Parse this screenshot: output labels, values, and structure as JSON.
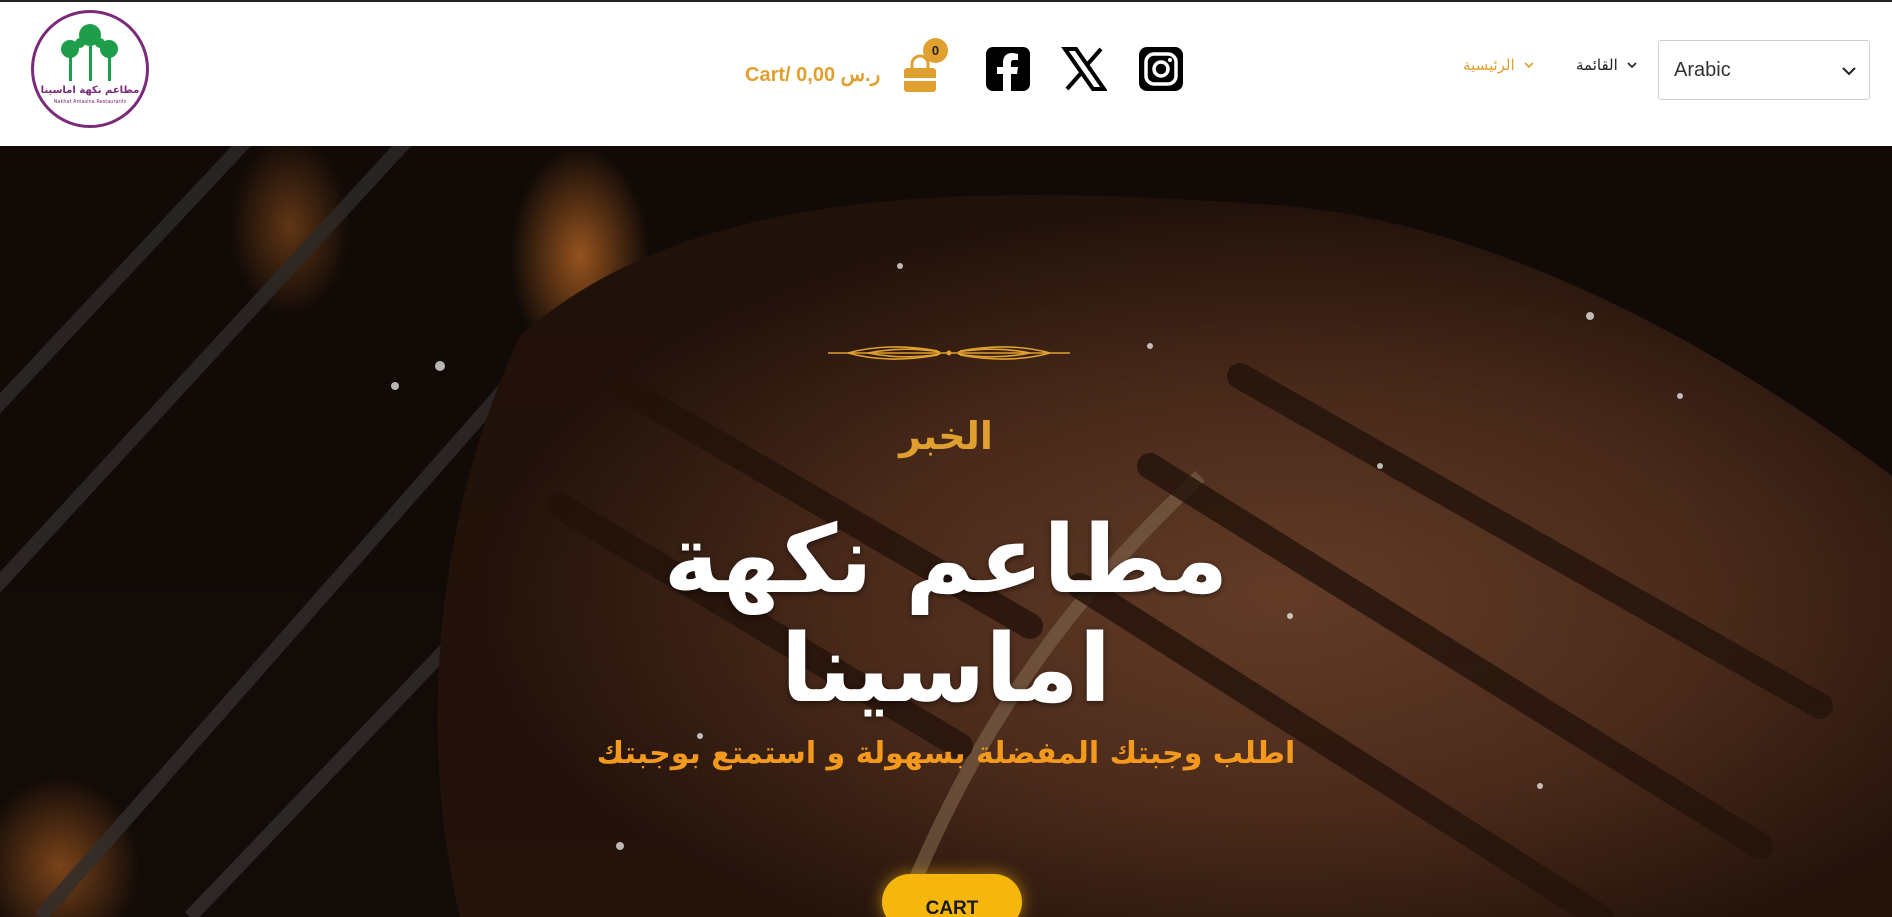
{
  "header": {
    "logo": {
      "name_ar": "مطاعم نكهة اماسينا",
      "name_en": "Nakhat Amasina Restaurants"
    },
    "cart": {
      "label": "Cart/",
      "amount": "0,00",
      "currency": "ر.س",
      "count": "0",
      "icon": "shopping-bag-icon"
    },
    "social": [
      {
        "icon": "facebook-icon"
      },
      {
        "icon": "x-twitter-icon"
      },
      {
        "icon": "instagram-icon"
      }
    ],
    "nav": [
      {
        "label": "الرئيسية",
        "active": true
      },
      {
        "label": "القائمة",
        "active": false
      }
    ],
    "language": {
      "selected": "Arabic"
    }
  },
  "hero": {
    "eyebrow": "الخبر",
    "title": "مطاعم نكهة اماسينا",
    "subtitle": "اطلب وجبتك المفضلة بسهولة و استمتع بوجبتك",
    "cta": "CART"
  },
  "colors": {
    "accent": "#e0a02f",
    "cta": "#f5b70e",
    "subtitle": "#f39a1e",
    "logo_border": "#7a2a78",
    "logo_palm": "#1e9e4a"
  }
}
